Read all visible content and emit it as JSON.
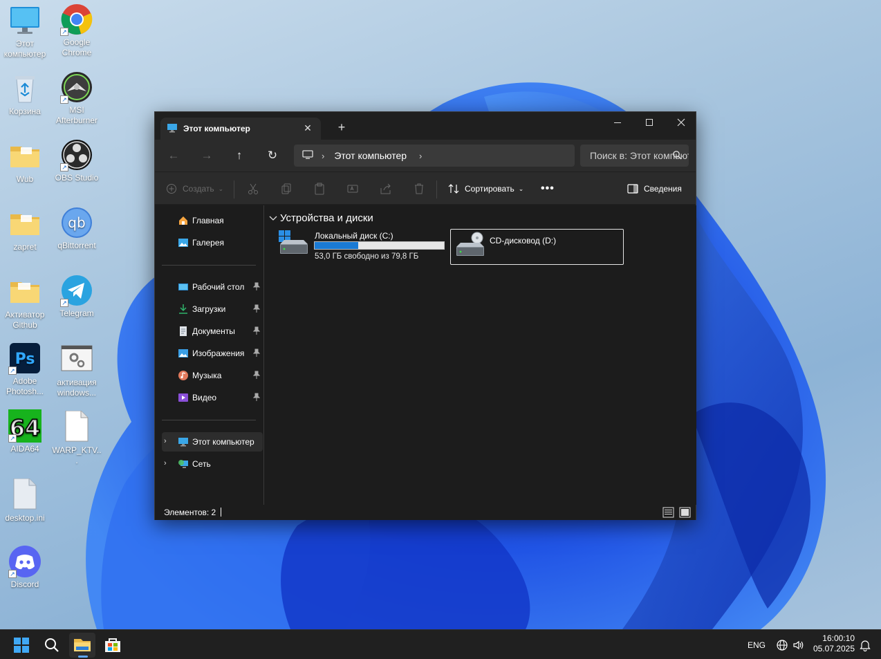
{
  "desktop": {
    "icons": [
      {
        "label": "Этот компьютер",
        "icon": "computer-icon"
      },
      {
        "label": "Google Chrome",
        "icon": "chrome-icon"
      },
      {
        "label": "Корзина",
        "icon": "recycle-bin-icon"
      },
      {
        "label": "MSI Afterburner",
        "icon": "msi-afterburner-icon"
      },
      {
        "label": "Wub",
        "icon": "folder-icon"
      },
      {
        "label": "OBS Studio",
        "icon": "obs-icon"
      },
      {
        "label": "zapret",
        "icon": "folder-icon"
      },
      {
        "label": "qBittorrent",
        "icon": "qbittorrent-icon"
      },
      {
        "label": "Активатор Github",
        "icon": "folder-icon"
      },
      {
        "label": "Telegram",
        "icon": "telegram-icon"
      },
      {
        "label": "Adobe Photosh...",
        "icon": "photoshop-icon"
      },
      {
        "label": "активация windows...",
        "icon": "settings-file-icon"
      },
      {
        "label": "AIDA64",
        "icon": "aida64-icon"
      },
      {
        "label": "WARP_KTV...",
        "icon": "file-icon"
      },
      {
        "label": "desktop.ini",
        "icon": "ini-file-icon"
      },
      {
        "label": "Discord",
        "icon": "discord-icon"
      }
    ]
  },
  "window": {
    "tab_title": "Этот компьютер",
    "address": {
      "crumb": "Этот компьютер"
    },
    "search": {
      "placeholder": "Поиск в: Этот компьютер"
    },
    "toolbar": {
      "create_label": "Создать",
      "sort_label": "Сортировать",
      "details_label": "Сведения"
    },
    "sidebar": {
      "quick": [
        {
          "label": "Главная",
          "icon": "home-icon"
        },
        {
          "label": "Галерея",
          "icon": "gallery-icon"
        }
      ],
      "pinned": [
        {
          "label": "Рабочий стол",
          "icon": "desktop-folder-icon"
        },
        {
          "label": "Загрузки",
          "icon": "downloads-icon"
        },
        {
          "label": "Документы",
          "icon": "documents-icon"
        },
        {
          "label": "Изображения",
          "icon": "pictures-icon"
        },
        {
          "label": "Музыка",
          "icon": "music-icon"
        },
        {
          "label": "Видео",
          "icon": "videos-icon"
        }
      ],
      "tree": [
        {
          "label": "Этот компьютер",
          "icon": "computer-icon",
          "selected": true
        },
        {
          "label": "Сеть",
          "icon": "network-icon",
          "selected": false
        }
      ]
    },
    "content": {
      "group_title": "Устройства и диски",
      "drives": [
        {
          "name": "Локальный диск (C:)",
          "free_text": "53,0 ГБ свободно из 79,8 ГБ",
          "used_fraction": 0.336
        },
        {
          "name": "CD-дисковод (D:)"
        }
      ]
    },
    "status": {
      "items_text": "Элементов: 2"
    }
  },
  "taskbar": {
    "language": "ENG",
    "time": "16:00:10",
    "date": "05.07.2025"
  },
  "colors": {
    "accent": "#1a7ad4",
    "window_bg": "#1c1c1c",
    "taskbar_bg": "#202020"
  }
}
